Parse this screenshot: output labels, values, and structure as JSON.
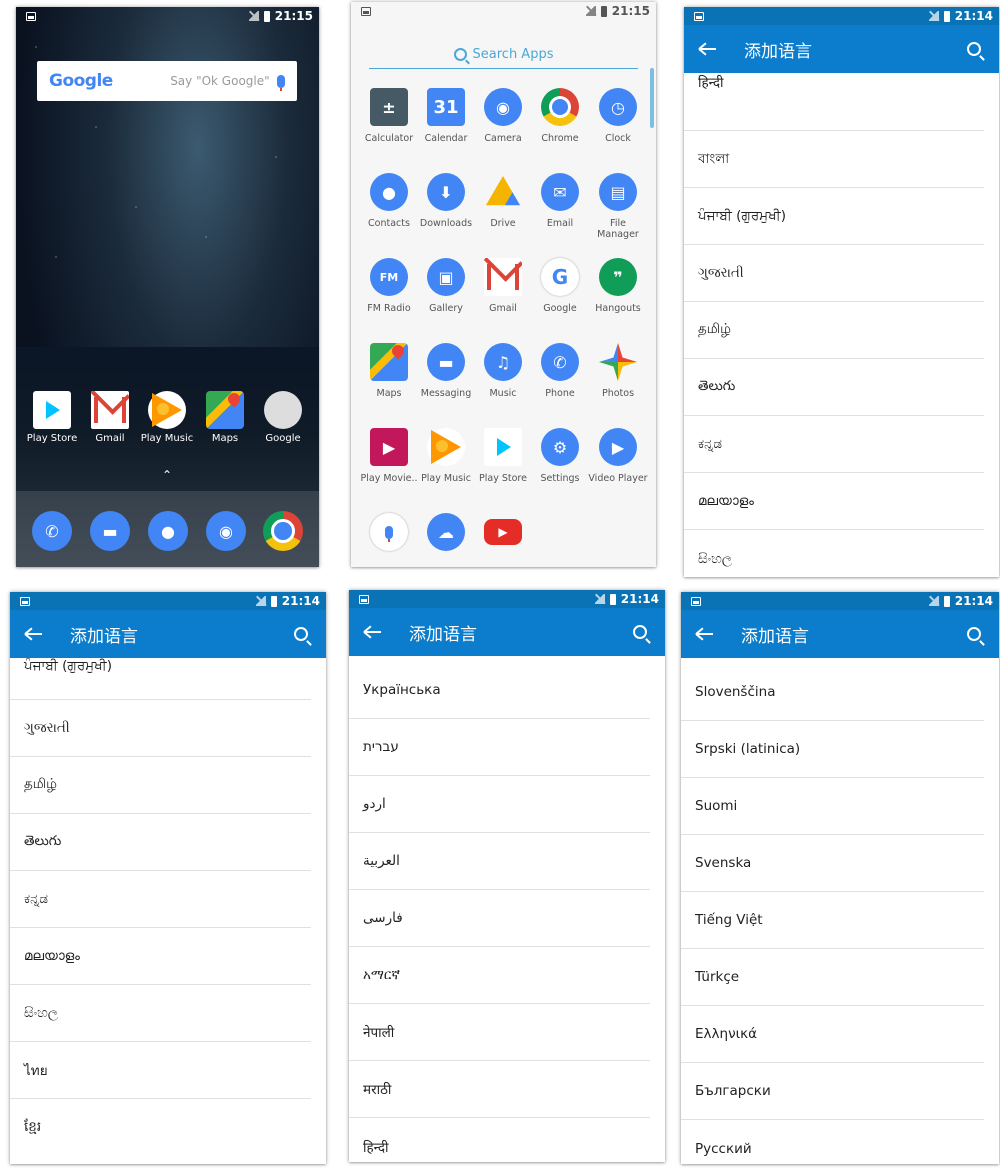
{
  "status": {
    "time_home": "21:15",
    "time_drawer": "21:15",
    "time_lang": "21:14"
  },
  "home": {
    "google_logo": "Google",
    "say_ok_google": "Say \"Ok Google\"",
    "apps": [
      "Play Store",
      "Gmail",
      "Play Music",
      "Maps",
      "Google"
    ],
    "dock_icons": [
      "phone-icon",
      "messaging-icon",
      "contacts-icon",
      "camera-icon",
      "chrome-icon"
    ]
  },
  "drawer": {
    "search_placeholder": "Search Apps",
    "apps": [
      "Calculator",
      "Calendar",
      "Camera",
      "Chrome",
      "Clock",
      "Contacts",
      "Downloads",
      "Drive",
      "Email",
      "File Manager",
      "FM Radio",
      "Gallery",
      "Gmail",
      "Google",
      "Hangouts",
      "Maps",
      "Messaging",
      "Music",
      "Phone",
      "Photos",
      "Play Movie..",
      "Play Music",
      "Play Store",
      "Settings",
      "Video Player"
    ],
    "calendar_day": "31",
    "fm_label": "FM",
    "colors": {
      "accent": "#4aa8d8",
      "blue": "#4285f4"
    }
  },
  "lang": {
    "title": "添加语言",
    "screen1": [
      "हिन्दी",
      "বাংলা",
      "ਪੰਜਾਬੀ (ਗੁਰਮੁਖੀ)",
      "ગુજરાતી",
      "தமிழ்",
      "తెలుగు",
      "ಕನ್ನಡ",
      "മലയാളം",
      "සිංහල"
    ],
    "screen2": [
      "ਪੰਜਾਬੀ (ਗੁਰਮੁਖੀ)",
      "ગુજરાતી",
      "தமிழ்",
      "తెలుగు",
      "ಕನ್ನಡ",
      "മലയാളം",
      "සිංහල",
      "ไทย",
      "ខ្មែរ"
    ],
    "screen3": [
      "Українська",
      "עברית",
      "اردو",
      "العربية",
      "فارسی",
      "አማርኛ",
      "नेपाली",
      "मराठी",
      "हिन्दी"
    ],
    "screen4": [
      "Slovenščina",
      "Srpski (latinica)",
      "Suomi",
      "Svenska",
      "Tiếng Việt",
      "Türkçe",
      "Ελληνικά",
      "Български",
      "Русский"
    ],
    "colors": {
      "appbar": "#0b7dcc",
      "statusbar": "#0a73b6"
    }
  }
}
